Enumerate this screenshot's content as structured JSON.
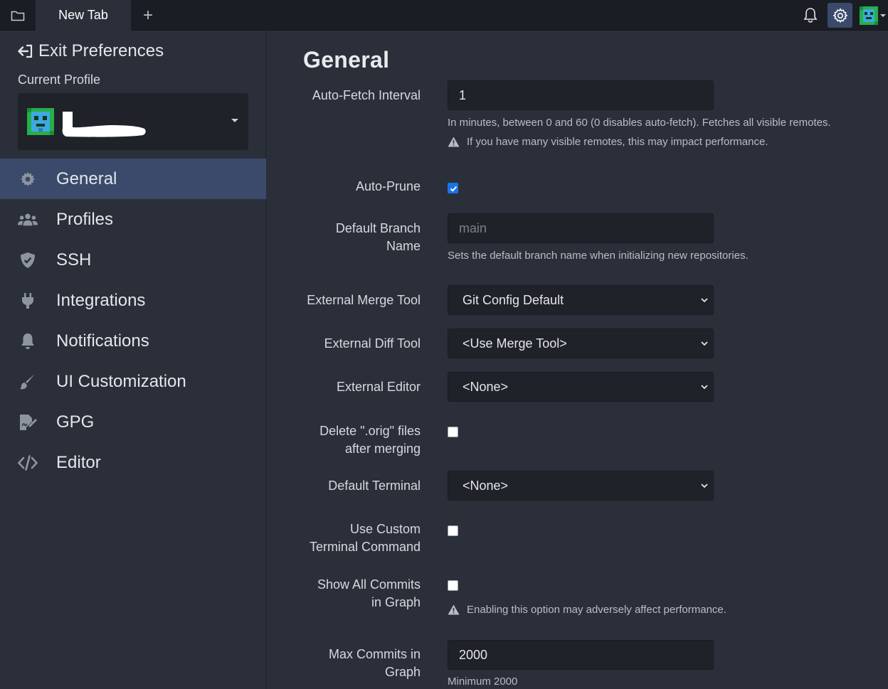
{
  "topbar": {
    "tab_label": "New Tab",
    "add_tab": "+"
  },
  "sidebar": {
    "exit_label": "Exit Preferences",
    "current_profile_label": "Current Profile",
    "nav": [
      {
        "label": "General",
        "icon": "gear-icon",
        "active": true
      },
      {
        "label": "Profiles",
        "icon": "users-icon"
      },
      {
        "label": "SSH",
        "icon": "shield-icon"
      },
      {
        "label": "Integrations",
        "icon": "plug-icon"
      },
      {
        "label": "Notifications",
        "icon": "bell-icon"
      },
      {
        "label": "UI Customization",
        "icon": "brush-icon"
      },
      {
        "label": "GPG",
        "icon": "signature-icon"
      },
      {
        "label": "Editor",
        "icon": "code-icon"
      }
    ]
  },
  "main": {
    "title": "General",
    "auto_fetch": {
      "label": "Auto-Fetch Interval",
      "value": "1",
      "help": "In minutes, between 0 and 60 (0 disables auto-fetch). Fetches all visible remotes.",
      "warning": "If you have many visible remotes, this may impact performance."
    },
    "auto_prune": {
      "label": "Auto-Prune",
      "checked": true
    },
    "default_branch": {
      "label_line1": "Default Branch",
      "label_line2": "Name",
      "placeholder": "main",
      "help": "Sets the default branch name when initializing new repositories."
    },
    "merge_tool": {
      "label": "External Merge Tool",
      "value": "Git Config Default"
    },
    "diff_tool": {
      "label": "External Diff Tool",
      "value": "<Use Merge Tool>"
    },
    "editor": {
      "label": "External Editor",
      "value": "<None>"
    },
    "delete_orig": {
      "label_line1": "Delete \".orig\" files",
      "label_line2": "after merging",
      "checked": false
    },
    "default_terminal": {
      "label": "Default Terminal",
      "value": "<None>"
    },
    "custom_terminal": {
      "label_line1": "Use Custom",
      "label_line2": "Terminal Command",
      "checked": false
    },
    "show_all_commits": {
      "label_line1": "Show All Commits",
      "label_line2": "in Graph",
      "checked": false,
      "warning": "Enabling this option may adversely affect performance."
    },
    "max_commits": {
      "label_line1": "Max Commits in",
      "label_line2": "Graph",
      "value": "2000",
      "help": "Minimum 2000"
    }
  },
  "colors": {
    "background": "#2b2f3a",
    "topbar": "#1b1d24",
    "input": "#1f2229",
    "active_nav": "#3b4a6b",
    "checkbox_checked": "#1a73e8"
  }
}
